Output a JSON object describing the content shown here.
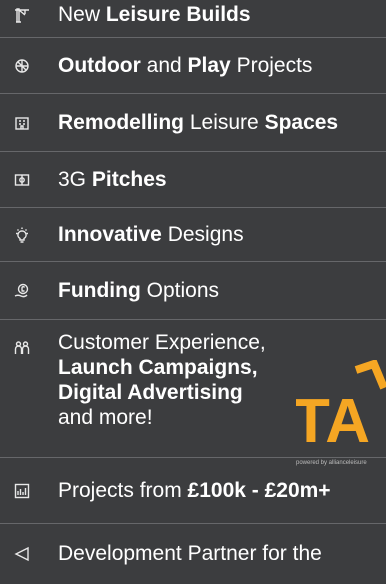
{
  "items": [
    {
      "icon": "crane-icon",
      "parts": [
        {
          "t": "New ",
          "b": false
        },
        {
          "t": "Leisure Builds",
          "b": true
        }
      ]
    },
    {
      "icon": "ball-icon",
      "parts": [
        {
          "t": "Outdoor",
          "b": true
        },
        {
          "t": " and ",
          "b": false
        },
        {
          "t": "Play",
          "b": true
        },
        {
          "t": " Projects",
          "b": false
        }
      ]
    },
    {
      "icon": "building-icon",
      "parts": [
        {
          "t": "Remodelling",
          "b": true
        },
        {
          "t": " Leisure ",
          "b": false
        },
        {
          "t": "Spaces",
          "b": true
        }
      ]
    },
    {
      "icon": "pitch-icon",
      "parts": [
        {
          "t": "3G ",
          "b": false
        },
        {
          "t": "Pitches",
          "b": true
        }
      ]
    },
    {
      "icon": "lightbulb-icon",
      "parts": [
        {
          "t": "Innovative",
          "b": true
        },
        {
          "t": " Designs",
          "b": false
        }
      ]
    },
    {
      "icon": "funding-icon",
      "parts": [
        {
          "t": "Funding",
          "b": true
        },
        {
          "t": " Options",
          "b": false
        }
      ]
    },
    {
      "icon": "people-icon",
      "lines": [
        "Customer Experience,",
        "Launch Campaigns,",
        "Digital Advertising",
        "and more!"
      ]
    },
    {
      "icon": "chart-icon",
      "parts": [
        {
          "t": "Projects from ",
          "b": false
        },
        {
          "t": "£100k - £20m+",
          "b": true
        }
      ]
    },
    {
      "icon": "arrow-left-icon",
      "parts": [
        {
          "t": "Development Partner for the",
          "b": false
        }
      ]
    }
  ],
  "logo": {
    "text": "TA",
    "powered": "powered by allianceleisure",
    "accent": "#f5a623"
  },
  "colors": {
    "bg": "#3c3d3f",
    "divider": "#66676a",
    "text": "#ffffff"
  }
}
